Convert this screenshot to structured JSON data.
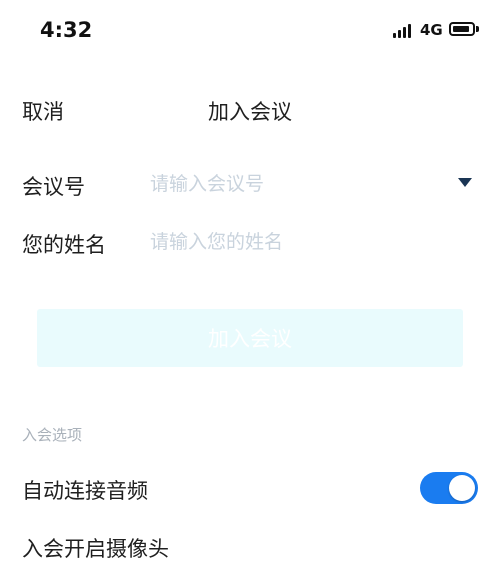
{
  "status_bar": {
    "time": "4:32",
    "network": "4G",
    "battery_level": 1.0
  },
  "header": {
    "cancel_label": "取消",
    "title": "加入会议"
  },
  "form": {
    "meeting_number": {
      "label": "会议号",
      "value": "",
      "placeholder": "请输入会议号"
    },
    "display_name": {
      "label": "您的姓名",
      "value": "",
      "placeholder": "请输入您的姓名"
    },
    "join_button_label": "加入会议"
  },
  "options": {
    "section_title": "入会选项",
    "auto_audio": {
      "label": "自动连接音频",
      "enabled": true
    },
    "camera_on": {
      "label": "入会开启摄像头"
    }
  },
  "colors": {
    "accent": "#1a7cf0",
    "button_disabled_bg": "#e9fbfd",
    "placeholder": "#c9d3dd",
    "section_title": "#a9b1ba",
    "dropdown_arrow": "#1a3554"
  }
}
